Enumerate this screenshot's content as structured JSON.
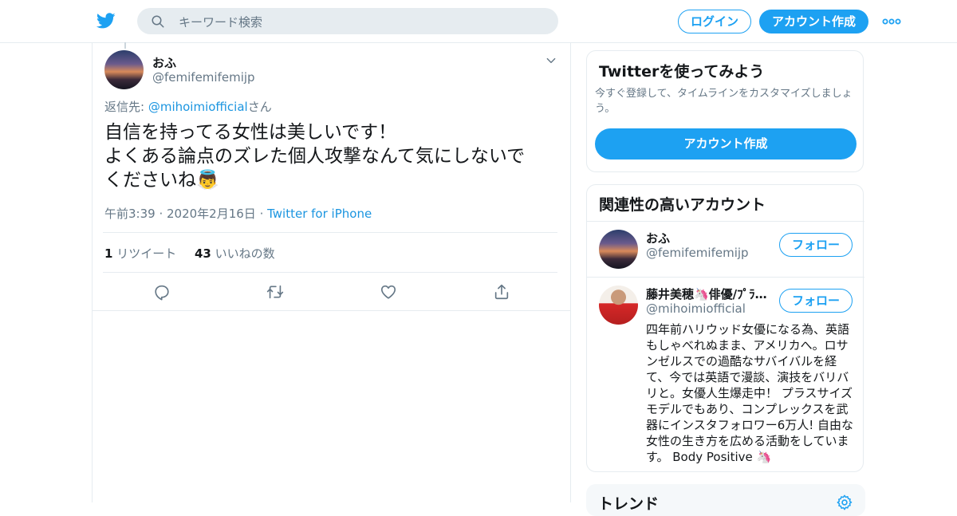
{
  "header": {
    "search_placeholder": "キーワード検索",
    "login_label": "ログイン",
    "signup_label": "アカウント作成",
    "brand_color": "#1da1f2"
  },
  "tweet": {
    "author_name": "おふ",
    "author_handle": "@femifemifemijp",
    "reply_prefix": "返信先: ",
    "reply_to": "@mihoimiofficial",
    "reply_suffix": "さん",
    "text_lines": [
      "自信を持ってる女性は美しいです！",
      "よくある論点のズレた個人攻撃なんて気にしないで",
      "くださいね👼"
    ],
    "timestamp": "午前3:39 · 2020年2月16日",
    "separator": " · ",
    "source": "Twitter for iPhone",
    "retweet_count": "1",
    "retweet_label": " リツイート",
    "like_count": "43",
    "like_label": " いいねの数",
    "actions": [
      "reply-icon",
      "retweet-icon",
      "like-icon",
      "share-icon"
    ]
  },
  "signup_card": {
    "title": "Twitterを使ってみよう",
    "description": "今すぐ登録して、タイムラインをカスタマイズしましょう。",
    "button_label": "アカウント作成"
  },
  "related_card": {
    "title": "関連性の高いアカウント",
    "accounts": [
      {
        "name": "おふ",
        "handle": "@femifemifemijp",
        "follow_label": "フォロー"
      },
      {
        "name": "藤井美穂🦄俳優/ﾌﾟﾗ…",
        "handle": "@mihoimiofficial",
        "follow_label": "フォロー",
        "bio_lines": [
          "四年前ハリウッド女優になる為、英語",
          "もしゃべれぬまま、アメリカへ。ロサ",
          "ンゼルスでの過酷なサバイバルを経",
          "て、今では英語で漫談、演技をバリバ",
          "リと。女優人生爆走中！ プラスサイズ",
          "モデルでもあり、コンプレックスを武",
          "器にインスタフォロワー6万人! 自由な",
          "女性の生き方を広める活動をしていま",
          "す。 Body Positive 🦄"
        ]
      }
    ]
  },
  "trends_card": {
    "title": "トレンド"
  }
}
